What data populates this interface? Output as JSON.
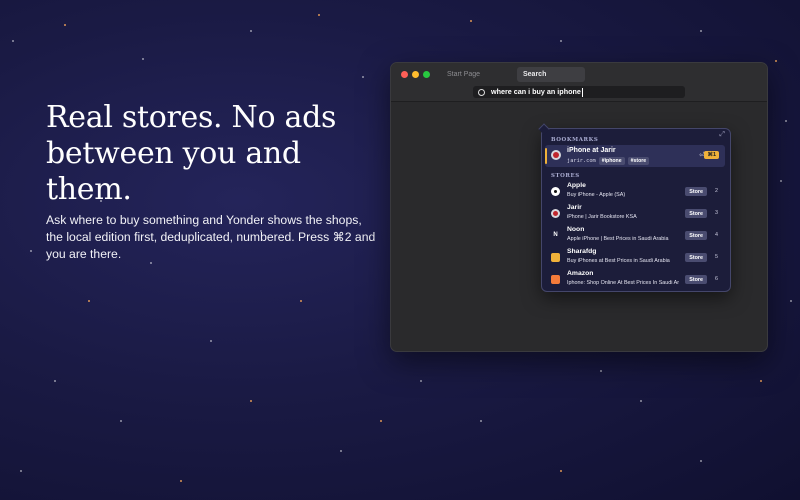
{
  "hero": {
    "headline_line1": "Real stores. No ads",
    "headline_line2": "between you and them.",
    "subtitle": "Ask where to buy something and Yonder shows the shops, the local edition first, deduplicated, numbered. Press ⌘2 and you are there."
  },
  "window": {
    "tabs": [
      "Start Page",
      "Search"
    ],
    "search_query": "where can i buy an iphone"
  },
  "dropdown": {
    "bookmarks_header": "BOOKMARKS",
    "bookmark": {
      "title": "iPhone at Jarir",
      "url": "jarir.com",
      "tags": [
        "#iphone",
        "#store"
      ],
      "return_glyph": "⏎",
      "shortcut": "⌘1"
    },
    "stores_header": "STORES",
    "stores": [
      {
        "name": "Apple",
        "desc": "Buy iPhone - Apple (SA)",
        "badge": "Store",
        "num": "2",
        "icon": "apple-icon"
      },
      {
        "name": "Jarir",
        "desc": "iPhone | Jarir Bookstore KSA",
        "badge": "Store",
        "num": "3",
        "icon": "jarir-icon"
      },
      {
        "name": "Noon",
        "desc": "Apple iPhone | Best Prices in Saudi Arabia",
        "badge": "Store",
        "num": "4",
        "icon": "noon-icon",
        "icon_letter": "N"
      },
      {
        "name": "Sharafdg",
        "desc": "Buy iPhones at Best Prices in Saudi Arabia",
        "badge": "Store",
        "num": "5",
        "icon": "sharafdg-icon"
      },
      {
        "name": "Amazon",
        "desc": "Iphone: Shop Online At Best Prices In Saudi Arabia",
        "badge": "Store",
        "num": "6",
        "icon": "amazon-icon"
      }
    ]
  },
  "colors": {
    "accent": "#f0b13a",
    "background": "#1a1a44",
    "panel": "#1c1d3a"
  }
}
